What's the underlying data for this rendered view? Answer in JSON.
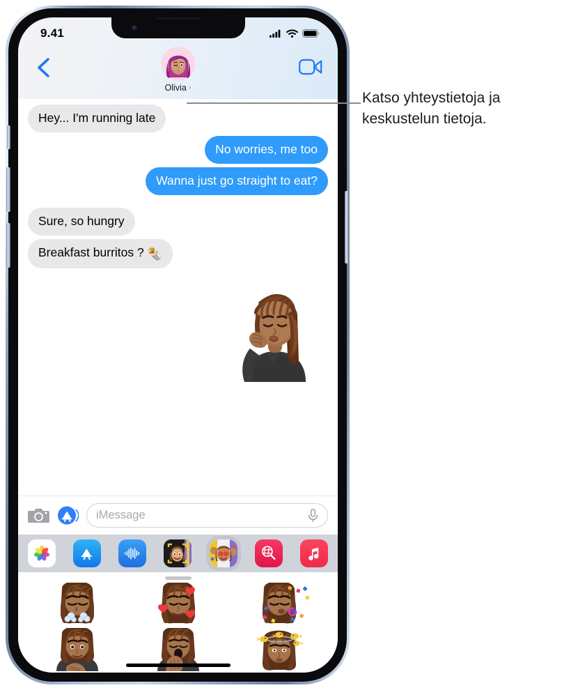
{
  "device": {
    "name": "iphone-13",
    "frame_color": "#b9c7dd"
  },
  "status_bar": {
    "time": "9.41",
    "cellular_icon": "signal-bars-icon",
    "wifi_icon": "wifi-icon",
    "battery_icon": "battery-icon"
  },
  "header": {
    "back_icon": "back-chevron-icon",
    "facetime_icon": "facetime-video-icon",
    "avatar_icon": "contact-avatar-memoji",
    "contact_name": "Olivia",
    "chevron": "›"
  },
  "conversation": {
    "messages": [
      {
        "text": "Hey... I'm running late",
        "direction": "incoming",
        "tail": true
      },
      {
        "text": "No worries, me too",
        "direction": "outgoing",
        "tail": false
      },
      {
        "text": "Wanna just go straight to eat?",
        "direction": "outgoing",
        "tail": true
      },
      {
        "text": "Sure, so hungry",
        "direction": "incoming",
        "tail": false
      },
      {
        "text": "Breakfast burritos ?",
        "direction": "incoming",
        "tail": true,
        "emoji": "🌯"
      }
    ],
    "sticker_in_thread": "memoji-chefs-kiss-sticker"
  },
  "input_bar": {
    "camera_icon": "camera-icon",
    "appstore_icon": "app-store-icon",
    "placeholder": "iMessage",
    "value": "",
    "mic_icon": "microphone-icon"
  },
  "app_drawer": {
    "apps": [
      {
        "name": "photos-app-icon",
        "label": "Photos",
        "selected": false
      },
      {
        "name": "app-store-app-icon",
        "label": "App Store",
        "selected": false
      },
      {
        "name": "audio-message-app-icon",
        "label": "Audio",
        "selected": false
      },
      {
        "name": "memoji-app-icon",
        "label": "Memoji",
        "selected": false
      },
      {
        "name": "memoji-stickers-app-icon",
        "label": "Memoji Stickers",
        "selected": true
      },
      {
        "name": "images-search-app-icon",
        "label": "#images",
        "selected": false
      },
      {
        "name": "music-app-icon",
        "label": "Music",
        "selected": false
      }
    ]
  },
  "sticker_panel": {
    "grabber": "drag-handle",
    "stickers": [
      {
        "name": "memoji-sticker-steam-nose",
        "label": "Steam from nose"
      },
      {
        "name": "memoji-sticker-hearts",
        "label": "Hearts"
      },
      {
        "name": "memoji-sticker-party",
        "label": "Party horn"
      },
      {
        "name": "memoji-sticker-shy-smile",
        "label": "Shy smile"
      },
      {
        "name": "memoji-sticker-yawn",
        "label": "Yawn"
      },
      {
        "name": "memoji-sticker-dizzy-birds",
        "label": "Dizzy birds"
      }
    ]
  },
  "callout": {
    "text": "Katso yhteystietoja ja keskustelun tietoja.",
    "line_color": "#8a8a8a"
  },
  "colors": {
    "bubble_outgoing": "#2f9bfa",
    "bubble_incoming": "#e8e8ea",
    "accent_blue": "#1d7cf2",
    "drawer_bg": "#d1d3da"
  }
}
